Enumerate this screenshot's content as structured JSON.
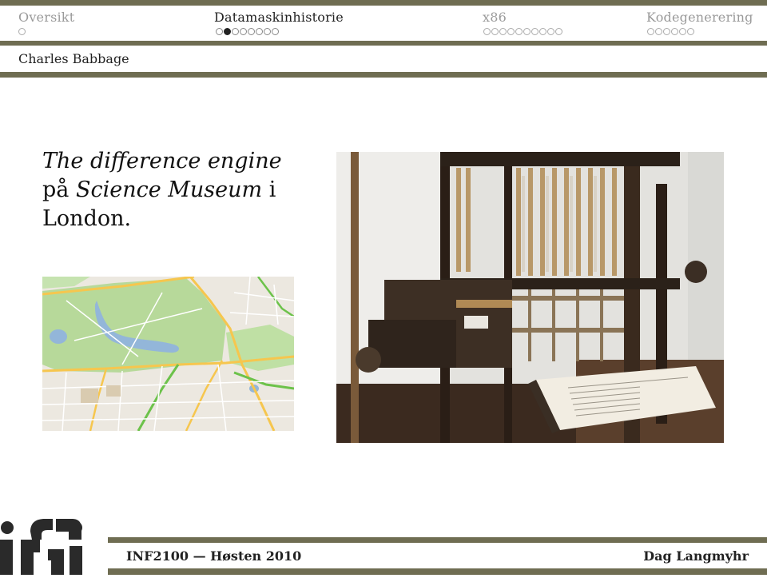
{
  "nav": {
    "sections": [
      {
        "label": "Oversikt",
        "dots": 1,
        "current": -1,
        "active": false
      },
      {
        "label": "Datamaskinhistorie",
        "dots": 8,
        "current": 1,
        "active": true
      },
      {
        "label": "x86",
        "dots": 10,
        "current": -1,
        "active": false
      },
      {
        "label": "Kodegenerering",
        "dots": 6,
        "current": -1,
        "active": false
      }
    ]
  },
  "frame": {
    "title": "Charles Babbage"
  },
  "content": {
    "line1_italic": "The difference engine",
    "line2_prefix": "på ",
    "line2_italic": "Science Museum",
    "line2_suffix": " i",
    "line3": "London."
  },
  "footer": {
    "left": "INF2100 — Høsten 2010",
    "right": "Dag Langmyhr"
  },
  "colors": {
    "bar": "#6f6d52",
    "logo": "#2a2a2a"
  }
}
